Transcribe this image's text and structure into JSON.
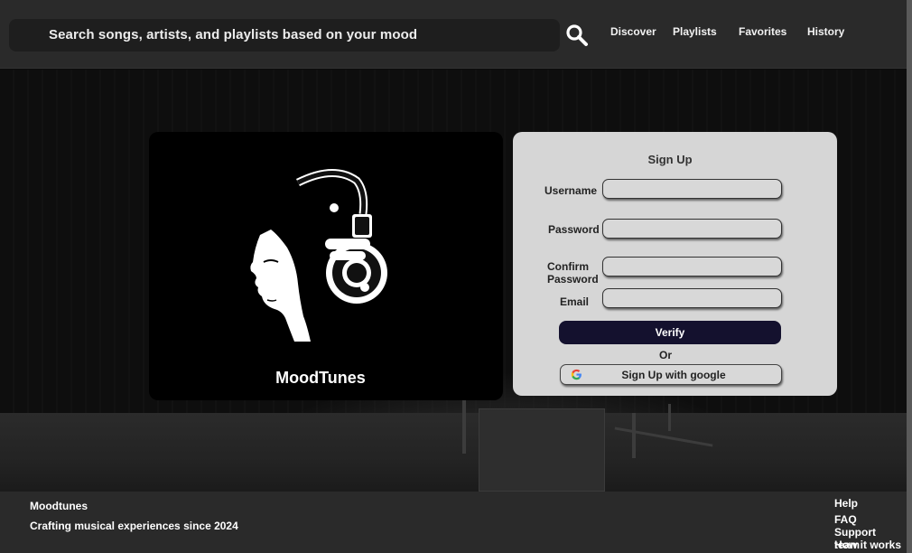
{
  "header": {
    "search": {
      "text": "Search songs, artists, and playlists based on your mood"
    },
    "search_icon": "magnifier-icon",
    "nav": [
      {
        "label": "Discover"
      },
      {
        "label": "Playlists"
      },
      {
        "label": "Favorites"
      },
      {
        "label": "History"
      }
    ]
  },
  "brand": {
    "name": "MoodTunes",
    "illustration": "woman-with-headphones-icon"
  },
  "signup": {
    "title": "Sign Up",
    "fields": [
      {
        "label": "Username",
        "value": ""
      },
      {
        "label": "Password",
        "value": ""
      },
      {
        "label": "Confirm Password",
        "value": ""
      },
      {
        "label": "Email",
        "value": ""
      }
    ],
    "verify_label": "Verify",
    "or_label": "Or",
    "google_label": "Sign Up with google",
    "google_icon": "google-g-icon"
  },
  "footer": {
    "title": "Moodtunes",
    "tagline": "Crafting musical experiences since 2024",
    "help_title": "Help",
    "help_links": [
      "FAQ",
      "Support",
      "team",
      "How it works"
    ]
  },
  "colors": {
    "header_bg": "#2a2a2a",
    "card_bg": "#d6d6d6",
    "verify_bg": "#14112e",
    "google_blue": "#4285F4",
    "google_red": "#EA4335",
    "google_yellow": "#FBBC05",
    "google_green": "#34A853"
  }
}
